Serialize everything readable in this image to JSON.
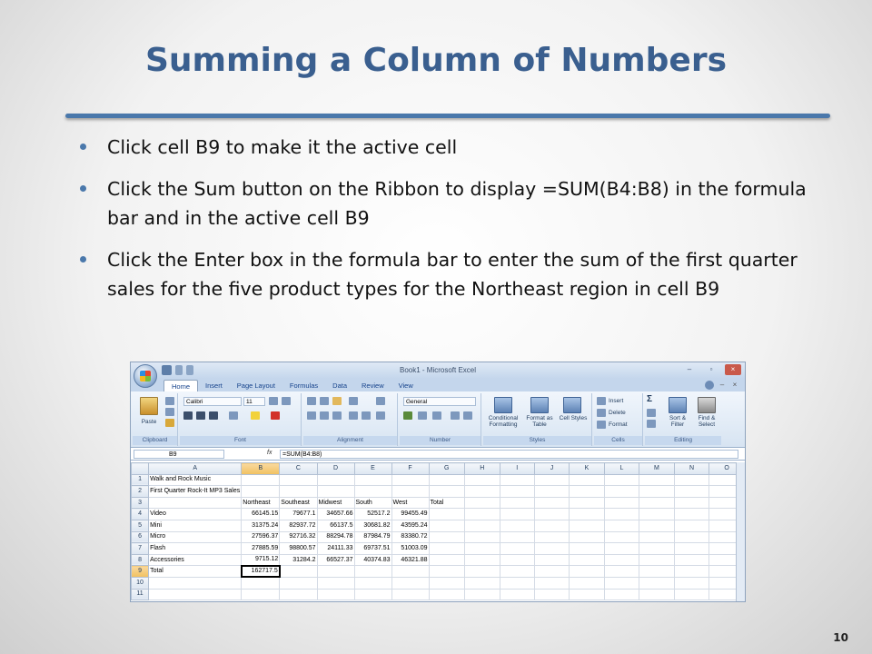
{
  "slide": {
    "title": "Summing a Column of Numbers",
    "bullets": [
      "Click cell B9 to make it the active cell",
      "Click the Sum button on the Ribbon to display =SUM(B4:B8) in the formula bar and in the active cell B9",
      "Click the Enter box in the formula bar to enter the sum of the first quarter sales for the five product types for the Northeast region in cell B9"
    ],
    "page_number": "10",
    "accent_color": "#4a78ab"
  },
  "excel": {
    "window_title": "Book1 - Microsoft Excel",
    "tabs": [
      "Home",
      "Insert",
      "Page Layout",
      "Formulas",
      "Data",
      "Review",
      "View"
    ],
    "active_tab": "Home",
    "ribbon": {
      "clipboard": {
        "label": "Clipboard",
        "paste": "Paste"
      },
      "font": {
        "label": "Font",
        "family": "Calibri",
        "size": "11"
      },
      "alignment": {
        "label": "Alignment"
      },
      "number": {
        "label": "Number",
        "format": "General"
      },
      "styles": {
        "label": "Styles",
        "conditional": "Conditional Formatting",
        "format_table": "Format as Table",
        "cell_styles": "Cell Styles"
      },
      "cells": {
        "label": "Cells",
        "insert": "Insert",
        "delete": "Delete",
        "format": "Format"
      },
      "editing": {
        "label": "Editing",
        "sort": "Sort & Filter",
        "find": "Find & Select"
      }
    },
    "name_box": "B9",
    "fx": "fx",
    "formula": "=SUM(B4:B8)",
    "columns": [
      "A",
      "B",
      "C",
      "D",
      "E",
      "F",
      "G",
      "H",
      "I",
      "J",
      "K",
      "L",
      "M",
      "N",
      "O"
    ],
    "rows": [
      [
        "Walk and Rock Music",
        "",
        "",
        "",
        "",
        "",
        ""
      ],
      [
        "First Quarter Rock-It MP3 Sales",
        "",
        "",
        "",
        "",
        "",
        ""
      ],
      [
        "",
        "Northeast",
        "Southeast",
        "Midwest",
        "South",
        "West",
        "Total"
      ],
      [
        "Video",
        "66145.15",
        "79677.1",
        "34657.66",
        "52517.2",
        "99455.49",
        ""
      ],
      [
        "Mini",
        "31375.24",
        "82937.72",
        "66137.5",
        "30681.82",
        "43595.24",
        ""
      ],
      [
        "Micro",
        "27596.37",
        "92716.32",
        "88294.78",
        "87984.79",
        "83380.72",
        ""
      ],
      [
        "Flash",
        "27885.59",
        "98800.57",
        "24111.33",
        "69737.51",
        "51003.09",
        ""
      ],
      [
        "Accessories",
        "9715.12",
        "31284.2",
        "66527.37",
        "40374.83",
        "46321.88",
        ""
      ],
      [
        "Total",
        "162717.5",
        "",
        "",
        "",
        "",
        ""
      ],
      [
        "",
        "",
        "",
        "",
        "",
        "",
        ""
      ],
      [
        "",
        "",
        "",
        "",
        "",
        "",
        ""
      ]
    ]
  }
}
